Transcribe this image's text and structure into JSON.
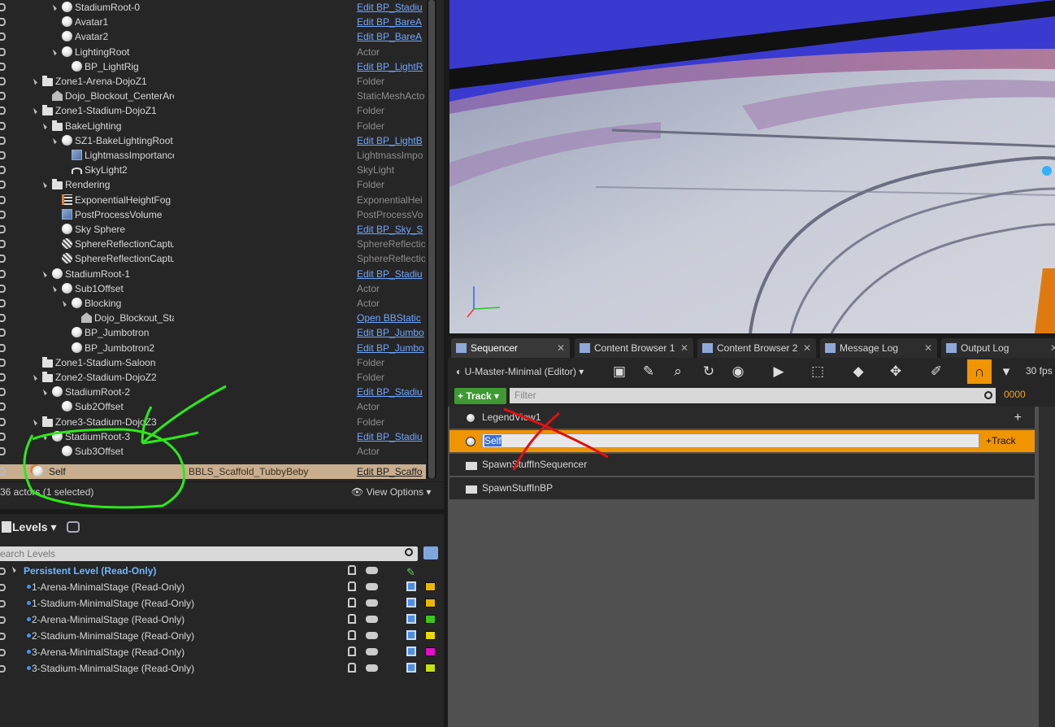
{
  "outliner": {
    "rows": [
      {
        "name": "StadiumRoot-0",
        "type": "Edit BP_Stadiu",
        "link": true,
        "icon": "ball"
      },
      {
        "name": "Avatar1",
        "type": "Edit BP_BareA",
        "link": true,
        "icon": "ball"
      },
      {
        "name": "Avatar2",
        "type": "Edit BP_BareA",
        "link": true,
        "icon": "ball"
      },
      {
        "name": "LightingRoot",
        "type": "Actor",
        "link": false,
        "icon": "ball"
      },
      {
        "name": "BP_LightRig",
        "type": "Edit BP_LightR",
        "link": true,
        "icon": "ball"
      },
      {
        "name": "Zone1-Arena-DojoZ1",
        "type": "Folder",
        "link": false,
        "icon": "folder"
      },
      {
        "name": "Dojo_Blockout_CenterAren",
        "type": "StaticMeshActo",
        "link": false,
        "icon": "mesh"
      },
      {
        "name": "Zone1-Stadium-DojoZ1",
        "type": "Folder",
        "link": false,
        "icon": "folder"
      },
      {
        "name": "BakeLighting",
        "type": "Folder",
        "link": false,
        "icon": "folder"
      },
      {
        "name": "SZ1-BakeLightingRoot",
        "type": "Edit BP_LightB",
        "link": true,
        "icon": "ball"
      },
      {
        "name": "LightmassImportance",
        "type": "LightmassImpo",
        "link": false,
        "icon": "cube"
      },
      {
        "name": "SkyLight2",
        "type": "SkyLight",
        "link": false,
        "icon": "sky"
      },
      {
        "name": "Rendering",
        "type": "Folder",
        "link": false,
        "icon": "folder"
      },
      {
        "name": "ExponentialHeightFog",
        "type": "ExponentialHei",
        "link": false,
        "icon": "fog"
      },
      {
        "name": "PostProcessVolume",
        "type": "PostProcessVo",
        "link": false,
        "icon": "cube"
      },
      {
        "name": "Sky Sphere",
        "type": "Edit BP_Sky_S",
        "link": true,
        "icon": "ball"
      },
      {
        "name": "SphereReflectionCaptur",
        "type": "SphereReflectio",
        "link": false,
        "icon": "refl"
      },
      {
        "name": "SphereReflectionCaptur",
        "type": "SphereReflectio",
        "link": false,
        "icon": "refl"
      },
      {
        "name": "StadiumRoot-1",
        "type": "Edit BP_Stadiu",
        "link": true,
        "icon": "ball"
      },
      {
        "name": "Sub1Offset",
        "type": "Actor",
        "link": false,
        "icon": "ball"
      },
      {
        "name": "Blocking",
        "type": "Actor",
        "link": false,
        "icon": "ball"
      },
      {
        "name": "Dojo_Blockout_Stau",
        "type": "Open BBStatic",
        "link": true,
        "icon": "mesh"
      },
      {
        "name": "BP_Jumbotron",
        "type": "Edit BP_Jumbo",
        "link": true,
        "icon": "ball"
      },
      {
        "name": "BP_Jumbotron2",
        "type": "Edit BP_Jumbo",
        "link": true,
        "icon": "ball"
      },
      {
        "name": "Zone1-Stadium-Saloon",
        "type": "Folder",
        "link": false,
        "icon": "folder"
      },
      {
        "name": "Zone2-Stadium-DojoZ2",
        "type": "Folder",
        "link": false,
        "icon": "folder"
      },
      {
        "name": "StadiumRoot-2",
        "type": "Edit BP_Stadiu",
        "link": true,
        "icon": "ball"
      },
      {
        "name": "Sub2Offset",
        "type": "Actor",
        "link": false,
        "icon": "ball"
      },
      {
        "name": "Zone3-Stadium-DojoZ3",
        "type": "Folder",
        "link": false,
        "icon": "folder"
      },
      {
        "name": "StadiumRoot-3",
        "type": "Edit BP_Stadiu",
        "link": true,
        "icon": "ball"
      },
      {
        "name": "Sub3Offset",
        "type": "Actor",
        "link": false,
        "icon": "ball"
      }
    ],
    "selected": {
      "name": "Self",
      "extra": "BBLS_Scaffold_TubbyBeby",
      "type": "Edit BP_Scaffo"
    },
    "count": "36 actors (1 selected)",
    "view_options": "View Options"
  },
  "levels": {
    "title": "Levels",
    "search_placeholder": "earch Levels",
    "items": [
      {
        "name": "Persistent Level (Read-Only)",
        "persistent": true,
        "color": ""
      },
      {
        "name": "1-Arena-MinimalStage (Read-Only)",
        "color": "#e8b800"
      },
      {
        "name": "1-Stadium-MinimalStage (Read-Only)",
        "color": "#e8b800"
      },
      {
        "name": "2-Arena-MinimalStage (Read-Only)",
        "color": "#3fc41a"
      },
      {
        "name": "2-Stadium-MinimalStage (Read-Only)",
        "color": "#e8d800"
      },
      {
        "name": "3-Arena-MinimalStage (Read-Only)",
        "color": "#e010c8"
      },
      {
        "name": "3-Stadium-MinimalStage (Read-Only)",
        "color": "#c8e010"
      }
    ]
  },
  "tabs": [
    {
      "label": "Sequencer",
      "active": true
    },
    {
      "label": "Content Browser 1",
      "active": false
    },
    {
      "label": "Content Browser 2",
      "active": false
    },
    {
      "label": "Message Log",
      "active": false
    },
    {
      "label": "Output Log",
      "active": false
    }
  ],
  "sequencer": {
    "sequence_name": "U-Master-Minimal (Editor)",
    "fps": "30 fps",
    "track_button": "+ Track",
    "filter_placeholder": "Filter",
    "frame": "0000",
    "tracks": [
      {
        "name": "LegendView1",
        "kind": "actor"
      },
      {
        "name": "Self",
        "kind": "actor",
        "editing": true,
        "add_track": "+Track"
      },
      {
        "name": "SpawnStuffInSequencer",
        "kind": "folder"
      },
      {
        "name": "SpawnStuffInBP",
        "kind": "folder"
      }
    ]
  },
  "colors": {
    "accent": "#f09400",
    "selected_row": "#c8ae8e",
    "link": "#6fa6ff",
    "track_green": "#3f9a33",
    "annotation_green": "#2ee81a",
    "annotation_red": "#e01010"
  }
}
